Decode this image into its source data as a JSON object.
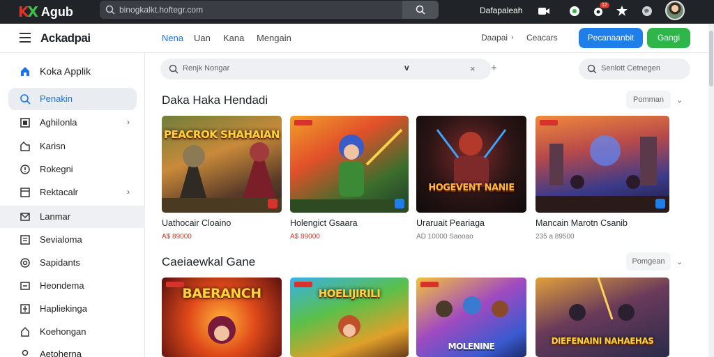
{
  "topbar": {
    "logo_text": "Agub",
    "url": "binogkalkt.hoftegr.com",
    "account_text": "Dafapaleah",
    "badge": "12"
  },
  "nav": {
    "brand": "Ackadpai",
    "links": [
      "Nena",
      "Uan",
      "Kana",
      "Mengain"
    ],
    "right_link": "Daapai",
    "right_link2": "Ceacars",
    "btn_primary": "Pecanaanbit",
    "btn_secondary": "Gangi"
  },
  "sidebar": {
    "items": [
      {
        "label": "Koka Applik",
        "icon": "home-icon"
      },
      {
        "label": "Penakin",
        "icon": "search-icon"
      },
      {
        "label": "Aghilonla",
        "icon": "grid-icon"
      },
      {
        "label": "Karisn",
        "icon": "tag-icon"
      },
      {
        "label": "Rokegni",
        "icon": "info-icon"
      },
      {
        "label": "Rektacalr",
        "icon": "panel-icon"
      },
      {
        "label": "Lanmar",
        "icon": "mail-icon"
      },
      {
        "label": "Sevialoma",
        "icon": "list-icon"
      },
      {
        "label": "Sapidants",
        "icon": "target-icon"
      },
      {
        "label": "Heondema",
        "icon": "minus-box-icon"
      },
      {
        "label": "Hapliekinga",
        "icon": "plus-box-icon"
      },
      {
        "label": "Koehongan",
        "icon": "shape-icon"
      },
      {
        "label": "Aetoherna",
        "icon": "user-icon"
      }
    ]
  },
  "search": {
    "main_placeholder": "Renjk Nongar",
    "side_placeholder": "Senlott Cetnegen"
  },
  "sections": [
    {
      "title": "Daka Haka Hendadi",
      "sort": "Pomman",
      "cards": [
        {
          "title": "Uathocair Cloaino",
          "price": "A$ 89000",
          "thumb_text": "PEACROK SHAHAIAN",
          "price_grey": false
        },
        {
          "title": "Holengict Gsaara",
          "price": "A$ 89000",
          "thumb_text": "",
          "price_grey": false
        },
        {
          "title": "Uraruait Peariaga",
          "price": "AD 10000 Saooao",
          "thumb_text": "HOGEVENT NANIE",
          "price_grey": true
        },
        {
          "title": "Mancain Marotn Csanib",
          "price": "235 a 89500",
          "thumb_text": "",
          "price_grey": true
        }
      ]
    },
    {
      "title": "Caeiaewkal Gane",
      "sort": "Pomgean",
      "cards": [
        {
          "title": "",
          "price": "",
          "thumb_text": "BAERANCH",
          "price_grey": false
        },
        {
          "title": "",
          "price": "",
          "thumb_text": "HOELIJIRILI",
          "price_grey": false
        },
        {
          "title": "",
          "price": "",
          "thumb_text": "MOLENINE",
          "price_grey": false
        },
        {
          "title": "",
          "price": "",
          "thumb_text": "DIEFENAINI NAHAEHAS",
          "price_grey": false
        }
      ]
    }
  ],
  "colors": {
    "accent_blue": "#1f7fe8",
    "accent_green": "#2fb54a",
    "price_red": "#e0342a",
    "topbar": "#202327"
  }
}
